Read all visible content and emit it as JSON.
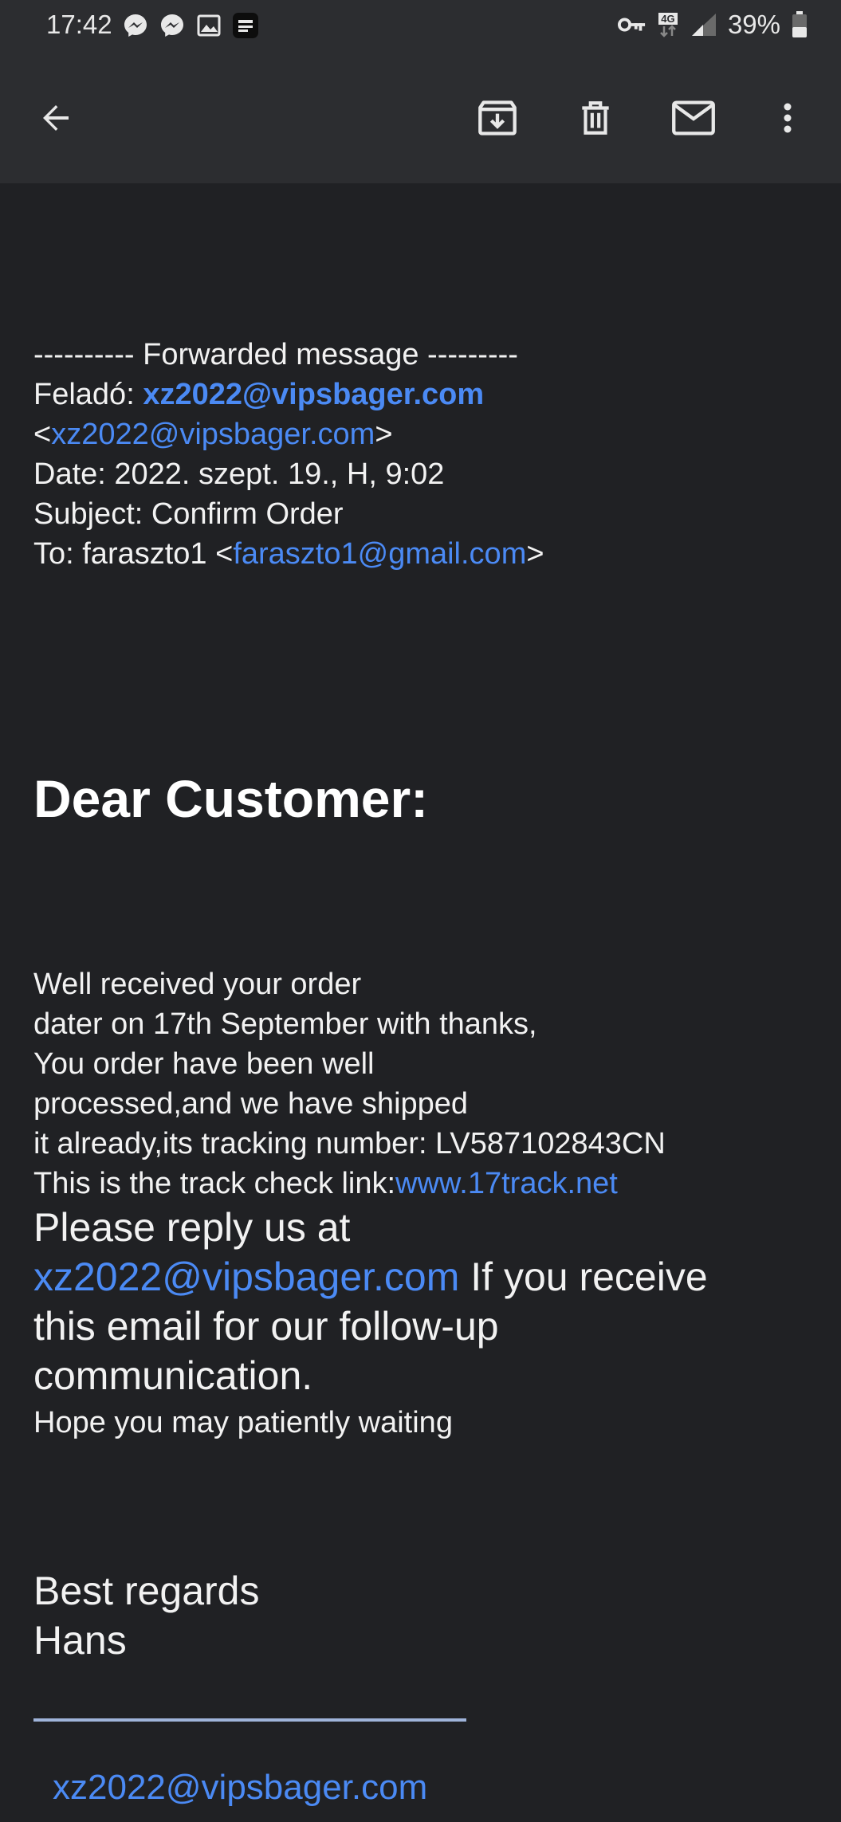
{
  "status_bar": {
    "time": "17:42",
    "network": "4G",
    "battery": "39%"
  },
  "toolbar": {
    "back_icon": "arrow-left-icon",
    "archive_icon": "archive-icon",
    "delete_icon": "trash-icon",
    "mark_unread_icon": "envelope-icon",
    "more_icon": "more-vert-icon"
  },
  "email": {
    "forward_header": "---------- Forwarded message ---------",
    "from_label": "Feladó: ",
    "from_name": "xz2022@vipsbager.com",
    "from_open": "<",
    "from_address": "xz2022@vipsbager.com",
    "from_close": ">",
    "date_line": "Date: 2022. szept. 19., H, 9:02",
    "subject_line": "Subject: Confirm Order",
    "to_prefix": "To: faraszto1 <",
    "to_address": "faraszto1@gmail.com",
    "to_close": ">",
    "greeting": "Dear Customer:",
    "body_lines": [
      "Well received your order",
      "dater on 17th September with thanks,",
      "You order have been well",
      "processed,and we have shipped",
      "it already,its tracking number: LV587102843CN"
    ],
    "track_prefix": "This is the track check link:",
    "track_link": "www.17track.net",
    "reply_line1": "Please reply us at",
    "reply_email": "xz2022@vipsbager.com",
    "reply_line2_suffix": " If you receive",
    "reply_line3": "this email for our follow-up",
    "reply_line4": "communication.",
    "hope_line": "Hope you may patiently waiting",
    "regards": "Best regards",
    "signature_name": "Hans",
    "signature_email": "xz2022@vipsbager.com"
  }
}
